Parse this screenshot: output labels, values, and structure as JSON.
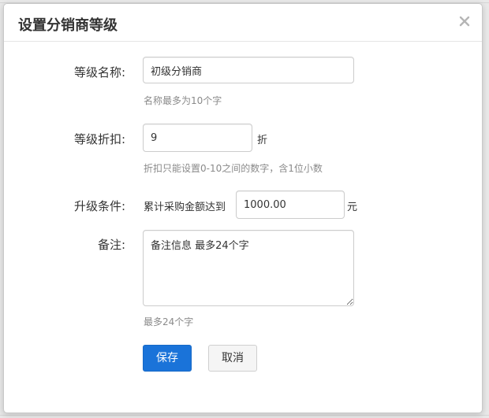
{
  "dialog": {
    "title": "设置分销商等级",
    "close_label": "×"
  },
  "form": {
    "level_name": {
      "label": "等级名称:",
      "value": "初级分销商",
      "help": "名称最多为10个字"
    },
    "discount": {
      "label": "等级折扣:",
      "value": "9",
      "unit": "折",
      "help": "折扣只能设置0-10之间的数字，含1位小数"
    },
    "upgrade": {
      "label": "升级条件:",
      "prefix": "累计采购金额达到",
      "value": "1000.00",
      "unit": "元"
    },
    "remark": {
      "label": "备注:",
      "value": "备注信息 最多24个字",
      "help": "最多24个字"
    }
  },
  "actions": {
    "save_label": "保存",
    "cancel_label": "取消"
  },
  "colors": {
    "primary": "#1a73d9",
    "help_text": "#8a8a8a"
  }
}
